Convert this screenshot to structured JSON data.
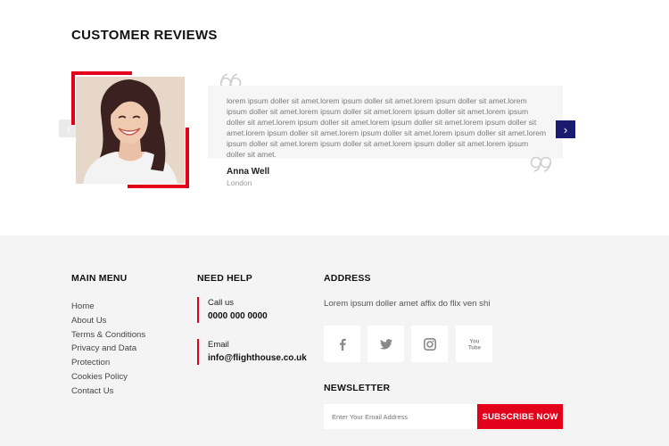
{
  "reviews": {
    "title_regular": "CUSTOMER",
    "title_bold": "REVIEWS",
    "prev_icon": "chevron-left-icon",
    "next_icon": "chevron-right-icon",
    "text": "lorem ipsum doller sit amet.lorem ipsum doller sit amet.lorem ipsum doller sit amet.lorem ipsum doller sit amet.lorem ipsum doller sit amet.lorem ipsum doller sit amet.lorem ipsum doller sit amet.lorem ipsum doller sit amet.lorem ipsum doller sit amet.lorem ipsum doller sit amet.lorem ipsum doller sit amet.lorem ipsum doller sit amet.lorem ipsum doller sit amet.lorem ipsum doller sit amet.lorem ipsum doller sit amet.lorem ipsum doller sit amet.lorem ipsum doller sit amet.",
    "name": "Anna Well",
    "location": "London",
    "accent_color": "#e2001a",
    "nav_color": "#1a1a6e"
  },
  "footer": {
    "main_menu": {
      "title": "MAIN MENU",
      "items": [
        "Home",
        "About Us",
        "Terms & Conditions",
        "Privacy and Data",
        "Protection",
        "Cookies Policy",
        "Contact Us"
      ]
    },
    "need_help": {
      "title": "NEED HELP",
      "call_label": "Call us",
      "call_value": "0000 000 0000",
      "email_label": "Email",
      "email_value": "info@flighthouse.co.uk"
    },
    "address": {
      "title": "ADDRESS",
      "text": "Lorem ipsum doller amet affix do flix ven shi"
    },
    "social": [
      "facebook-icon",
      "twitter-icon",
      "instagram-icon",
      "youtube-icon"
    ],
    "newsletter": {
      "title": "NEWSLETTER",
      "placeholder": "Enter Your Email Address",
      "button_label": "SUBSCRIBE NOW"
    }
  }
}
